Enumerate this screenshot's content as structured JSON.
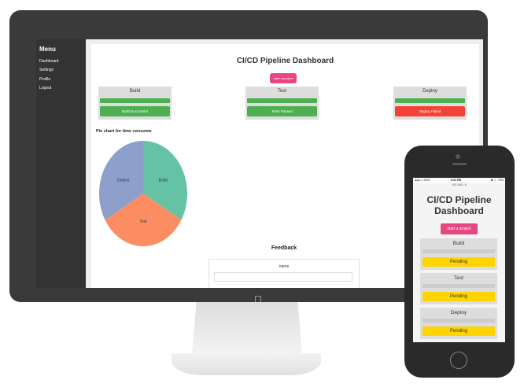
{
  "desktop": {
    "sidebar": {
      "title": "Menu",
      "items": [
        {
          "label": "Dashboard"
        },
        {
          "label": "Settings"
        },
        {
          "label": "Profile"
        },
        {
          "label": "Logout"
        }
      ]
    },
    "main": {
      "title": "CI/CD Pipeline Dashboard",
      "start_button": "start a project",
      "stages": [
        {
          "name": "Build",
          "status": "Build Successful",
          "status_color": "#4caf50",
          "progress": 1.0
        },
        {
          "name": "Test",
          "status": "Tests Passed",
          "status_color": "#4caf50",
          "progress": 1.0
        },
        {
          "name": "Deploy",
          "status": "Deploy Failed",
          "status_color": "#f44336",
          "progress": 1.0
        }
      ],
      "pie_heading": "Pie chart for time consume",
      "feedback": {
        "title": "Feedback",
        "name_label": "name",
        "name_value": ""
      }
    }
  },
  "chart_data": {
    "type": "pie",
    "title": "Pie chart for time consume",
    "slices": [
      {
        "label": "Build",
        "value": 33.3,
        "color": "#66c2a5"
      },
      {
        "label": "Test",
        "value": 33.3,
        "color": "#fc8d62"
      },
      {
        "label": "Deploy",
        "value": 33.4,
        "color": "#8da0cb"
      }
    ]
  },
  "mobile": {
    "status_bar": {
      "carrier": "●●●○○ AT&T",
      "time": "3:21 PM",
      "battery": "✱ ⚡ 70%",
      "url": "192.168.1.6"
    },
    "title": "CI/CD Pipeline Dashboard",
    "start_button": "start a project",
    "stages": [
      {
        "name": "Build",
        "status": "Pending",
        "status_color": "#ffd400"
      },
      {
        "name": "Test",
        "status": "Pending",
        "status_color": "#ffd400"
      },
      {
        "name": "Deploy",
        "status": "Pending",
        "status_color": "#ffd400"
      }
    ]
  },
  "icons": {
    "apple_logo": "apple-logo-icon"
  }
}
